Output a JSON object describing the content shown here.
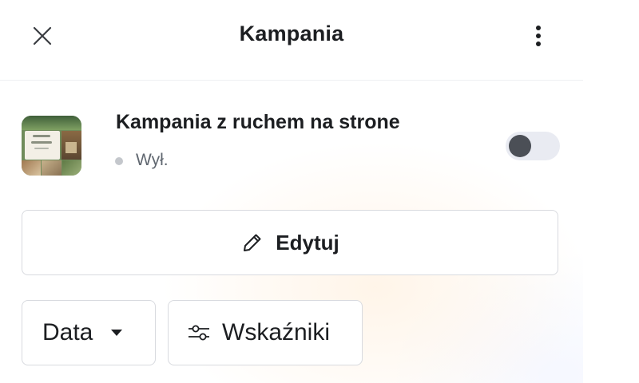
{
  "header": {
    "title": "Kampania",
    "close_icon": "close-icon",
    "more_icon": "more-vertical-icon"
  },
  "campaign": {
    "thumbnail_icon": "campaign-thumbnail",
    "title": "Kampania z ruchem na strone",
    "status": "Wył.",
    "status_color": "#c4c7cc",
    "toggle_on": false
  },
  "actions": {
    "edit_label": "Edytuj",
    "edit_icon": "pencil-icon"
  },
  "filters": {
    "date_label": "Data",
    "date_icon": "caret-down-icon",
    "metrics_label": "Wskaźniki",
    "metrics_icon": "sliders-icon"
  },
  "colors": {
    "text_primary": "#1c1e21",
    "text_secondary": "#606770",
    "border": "#d8dadf",
    "toggle_track": "#e9ebf2",
    "toggle_knob": "#4b4f56"
  }
}
